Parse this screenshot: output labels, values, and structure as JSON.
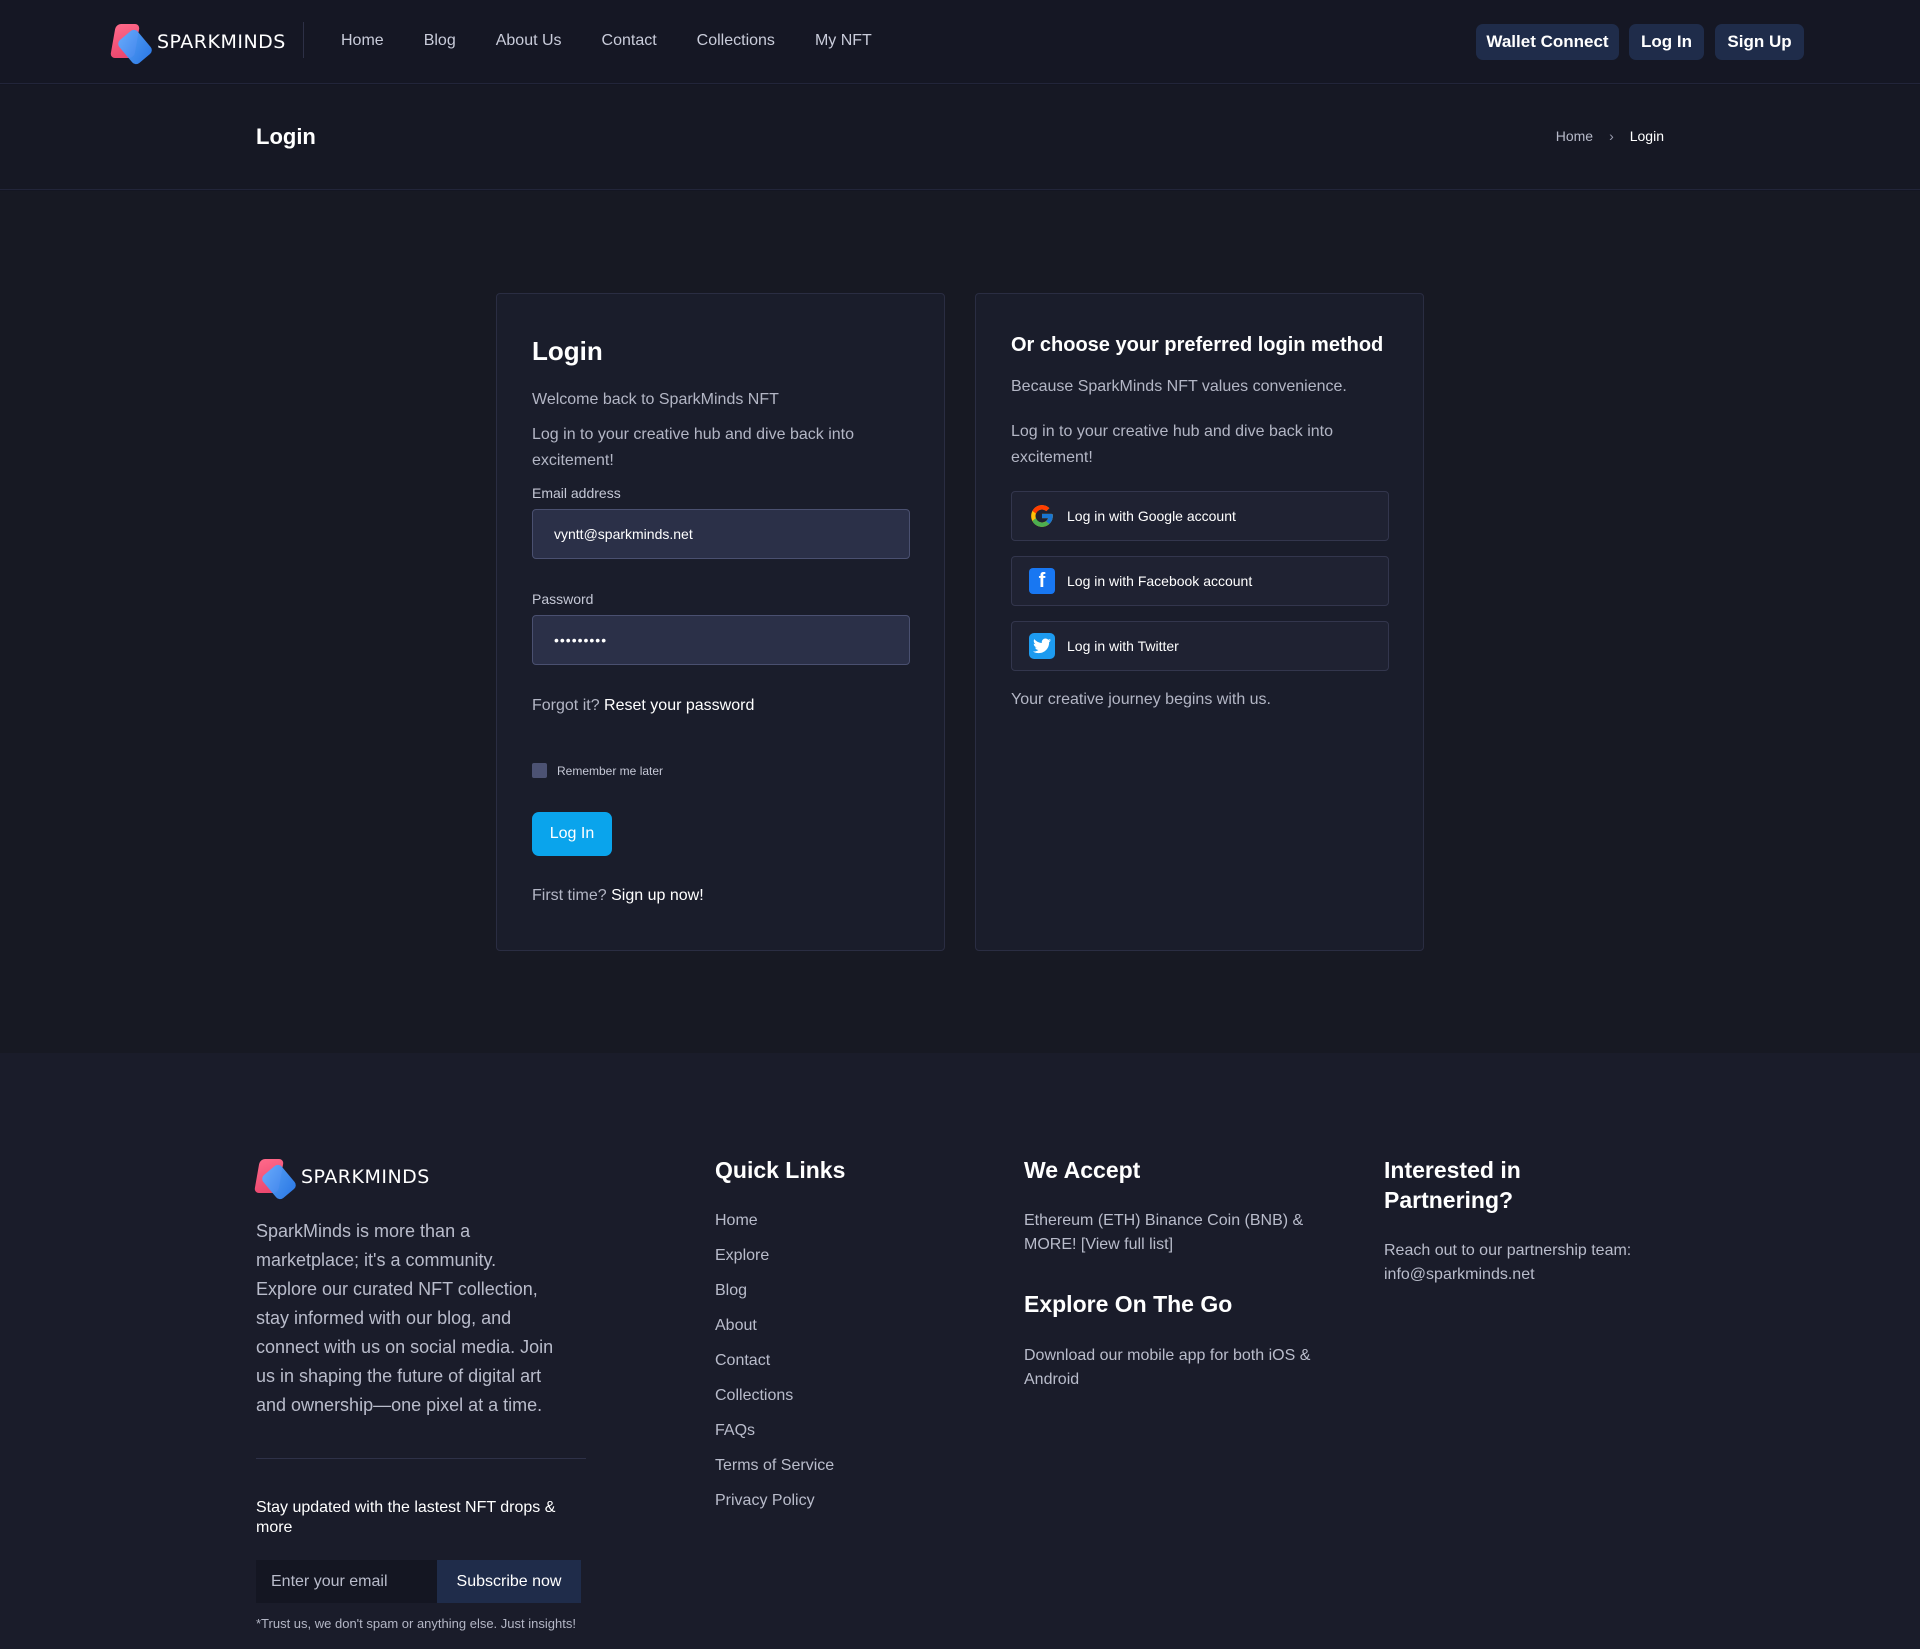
{
  "brand": {
    "name": "SPARKMINDS"
  },
  "nav": {
    "items": [
      "Home",
      "Blog",
      "About Us",
      "Contact",
      "Collections",
      "My NFT"
    ],
    "wallet": "Wallet Connect",
    "login": "Log In",
    "signup": "Sign Up"
  },
  "title_strip": {
    "title": "Login",
    "breadcrumb": {
      "home": "Home",
      "sep": "›",
      "current": "Login"
    }
  },
  "login_card": {
    "title": "Login",
    "welcome": "Welcome back to SparkMinds NFT",
    "intro": "Log in to your creative hub and dive back into excitement!",
    "email_label": "Email address",
    "email_value": "vyntt@sparkminds.net",
    "password_label": "Password",
    "password_value": "•••••••••",
    "forgot_q": "Forgot it?",
    "forgot_link": "Reset your password",
    "remember": "Remember me later",
    "submit": "Log In",
    "first_q": "First time?",
    "signup_link": "Sign up now!"
  },
  "alt_card": {
    "title": "Or choose your preferred login method",
    "subtitle": "Because SparkMinds NFT values convenience.",
    "intro": "Log in to your creative hub and dive back into excitement!",
    "google": "Log in with Google account",
    "facebook": "Log in with Facebook account",
    "twitter": "Log in with Twitter",
    "journey": "Your creative journey begins with us."
  },
  "footer": {
    "about": "SparkMinds is more than a marketplace; it's a community. Explore our curated NFT collection, stay informed with our blog, and connect with us on social media. Join us in shaping the future of digital art and ownership—one pixel at a time.",
    "stay": "Stay updated with the lastest NFT drops & more",
    "email_placeholder": "Enter your email",
    "subscribe": "Subscribe now",
    "trust": "*Trust us, we don't spam or anything else. Just insights!",
    "quick_links_title": "Quick Links",
    "quick_links": [
      "Home",
      "Explore",
      "Blog",
      "About",
      "Contact",
      "Collections",
      "FAQs",
      "Terms of Service",
      "Privacy Policy"
    ],
    "we_accept_title": "We Accept",
    "we_accept": "Ethereum (ETH) Binance Coin (BNB) & MORE! [View full list]",
    "explore_title": "Explore On The Go",
    "explore": "Download our mobile app for both iOS & Android",
    "partner_title": "Interested in Partnering?",
    "partner": "Reach out to our partnership team: info@sparkminds.net"
  },
  "colors": {
    "background": "#141622",
    "accent_button": "#0aa4ec",
    "dark_button": "#1f2c4a",
    "logo_pink": "#e8436b",
    "logo_blue": "#2f7ff0"
  },
  "icons": [
    "google-icon",
    "facebook-icon",
    "twitter-icon",
    "chevron-right-icon",
    "sparkminds-logo-icon"
  ]
}
